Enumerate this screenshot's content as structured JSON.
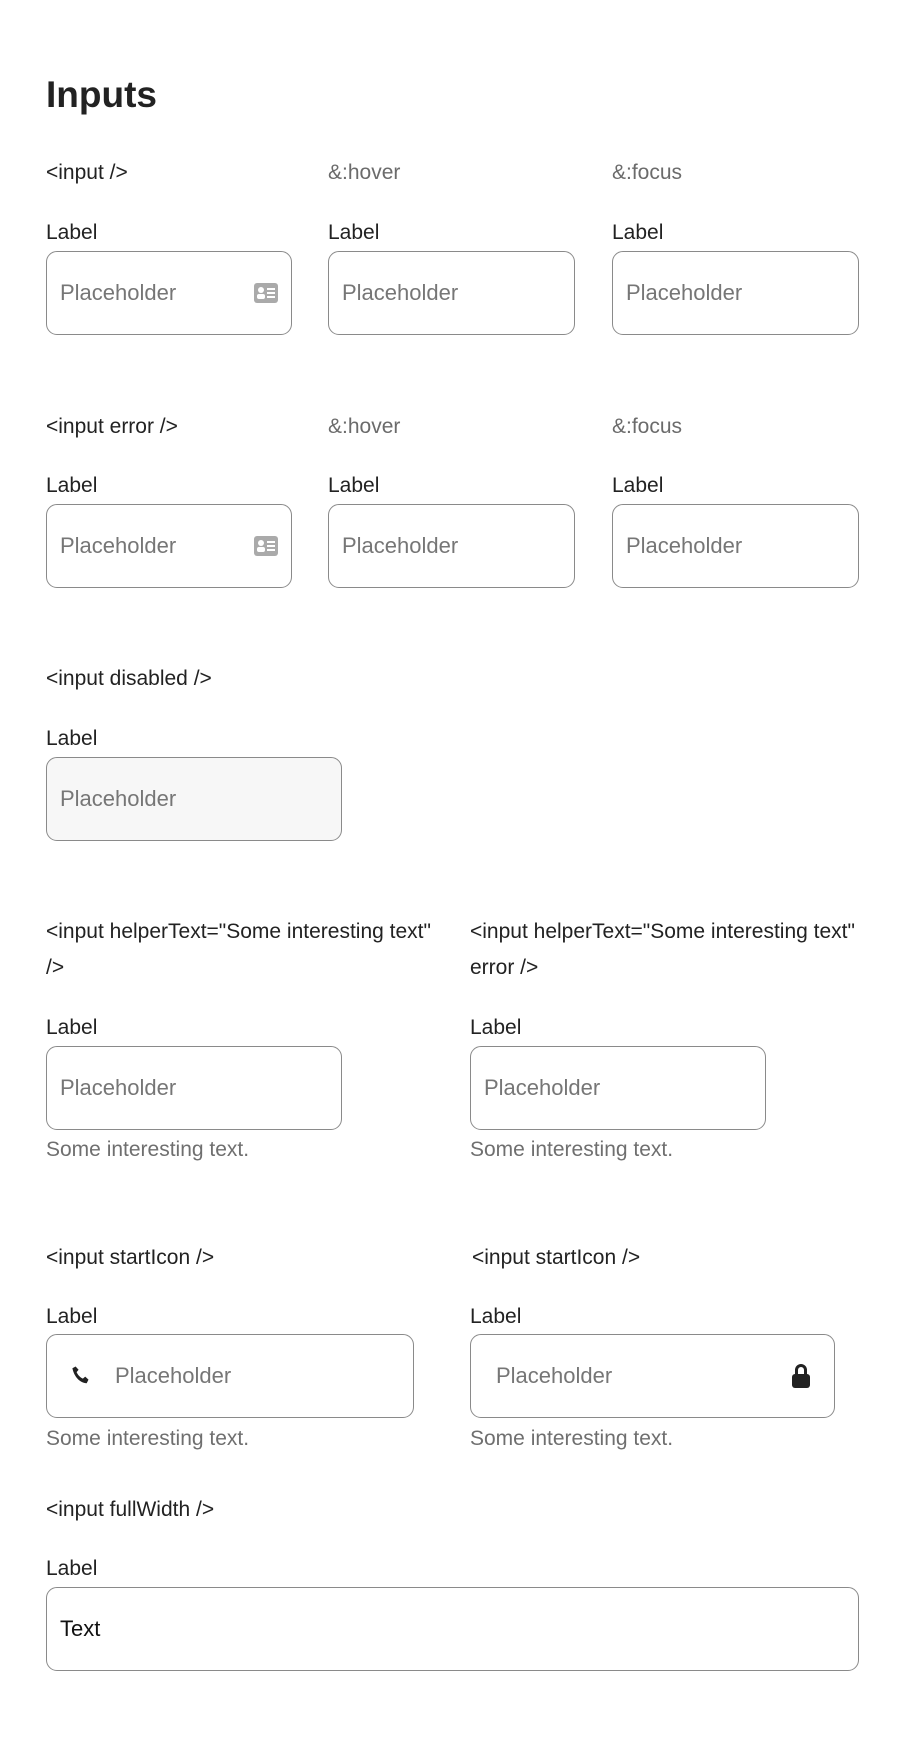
{
  "title": "Inputs",
  "sections": {
    "basic": {
      "heading": "<input />",
      "hover": "&:hover",
      "focus": "&:focus"
    },
    "error": {
      "heading": "<input error />",
      "hover": "&:hover",
      "focus": "&:focus"
    },
    "disabled": {
      "heading": "<input disabled />"
    },
    "helper": {
      "heading": "<input helperText=\"Some interesting text\" />",
      "heading_error": "<input helperText=\"Some interesting text\" error />"
    },
    "startIcon": {
      "heading_left": "<input startIcon />",
      "heading_right": "<input startIcon />"
    },
    "fullWidth": {
      "heading": "<input fullWidth />"
    }
  },
  "field": {
    "label": "Label",
    "placeholder": "Placeholder",
    "helper_text": "Some interesting text.",
    "full_width_value": "Text"
  },
  "icons": {
    "basic_end": "contact-card-icon",
    "start": "phone-icon",
    "end": "lock-icon"
  }
}
